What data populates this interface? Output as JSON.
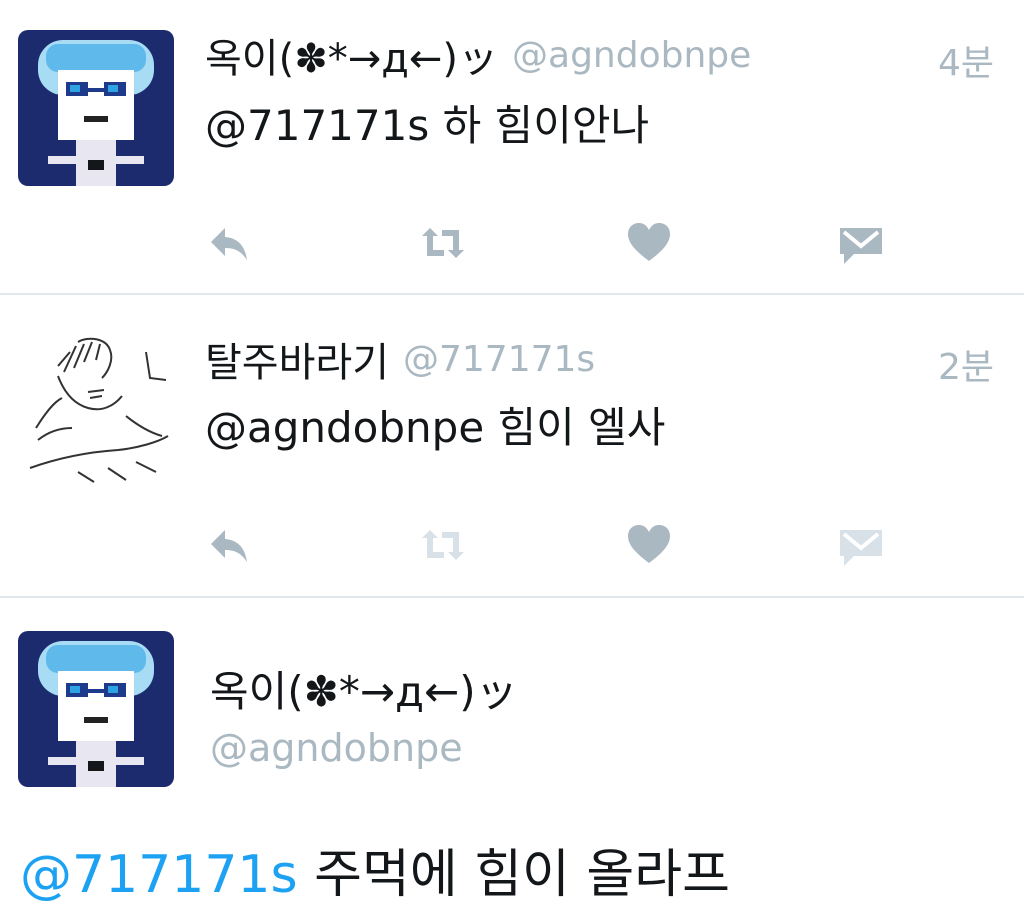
{
  "colors": {
    "muted": "#aab8c2",
    "link": "#1da1f2",
    "text": "#14171a",
    "divider": "#e1e8ed"
  },
  "tweets": [
    {
      "name": "옥이(✽*→д←)ッ",
      "handle": "@agndobnpe",
      "time": "4분",
      "text": "@717171s 하 힘이안나",
      "avatar": "pixel-art-avatar",
      "actions": [
        "reply-icon",
        "retweet-icon",
        "like-icon",
        "direct-message-icon"
      ]
    },
    {
      "name": "탈주바라기",
      "handle": "@717171s",
      "time": "2분",
      "text": "@agndobnpe 힘이 엘사",
      "avatar": "sketch-avatar",
      "actions": [
        "reply-icon",
        "retweet-icon",
        "like-icon",
        "direct-message-icon"
      ]
    }
  ],
  "main_tweet": {
    "name": "옥이(✽*→д←)ッ",
    "handle": "@agndobnpe",
    "mention": "@717171s",
    "text": " 주먹에 힘이 올라프",
    "avatar": "pixel-art-avatar"
  }
}
